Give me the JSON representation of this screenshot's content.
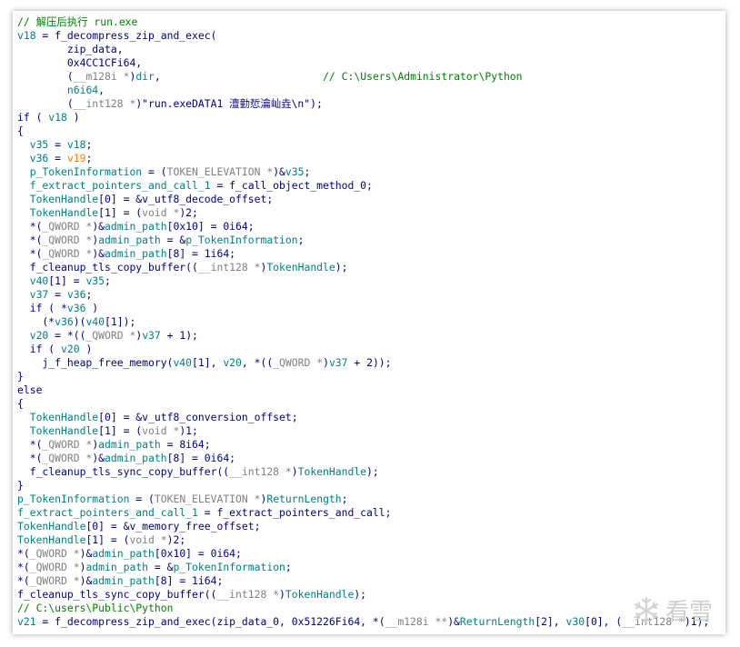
{
  "colors": {
    "background": "#ffffff",
    "text_navy": "#000080",
    "variable_teal": "#008080",
    "type_gray": "#808080",
    "comment_green": "#008000",
    "highlight_orange": "#ff8000"
  },
  "watermark": {
    "text": "看雪",
    "icon": "snowflake-icon"
  },
  "lines": [
    [
      [
        "c",
        "// 解压后执行 run.exe"
      ]
    ],
    [
      [
        "v",
        "v18"
      ],
      [
        "n",
        " = f_decompress_zip_and_exec("
      ]
    ],
    [
      [
        "n",
        "        zip_data,"
      ]
    ],
    [
      [
        "n",
        "        0x4CC1CFi64,"
      ]
    ],
    [
      [
        "n",
        "        ("
      ],
      [
        "y",
        "__m128i *"
      ],
      [
        "n",
        ")"
      ],
      [
        "v",
        "dir"
      ],
      [
        "n",
        ",                          "
      ],
      [
        "c",
        "// C:\\Users\\Administrator\\Python"
      ]
    ],
    [
      [
        "n",
        "        "
      ],
      [
        "v",
        "n6i64"
      ],
      [
        "n",
        ","
      ]
    ],
    [
      [
        "n",
        "        ("
      ],
      [
        "y",
        "__int128 *"
      ],
      [
        "n",
        ")\"run.exeDATA1 澶勭悊瀹屾垚\\n\");"
      ]
    ],
    [
      [
        "n",
        "if ( "
      ],
      [
        "v",
        "v18"
      ],
      [
        "n",
        " )"
      ]
    ],
    [
      [
        "n",
        "{"
      ]
    ],
    [
      [
        "n",
        "  "
      ],
      [
        "v",
        "v35"
      ],
      [
        "n",
        " = "
      ],
      [
        "v",
        "v18"
      ],
      [
        "n",
        ";"
      ]
    ],
    [
      [
        "n",
        "  "
      ],
      [
        "v",
        "v36"
      ],
      [
        "n",
        " = "
      ],
      [
        "o",
        "v19"
      ],
      [
        "n",
        ";"
      ]
    ],
    [
      [
        "n",
        "  "
      ],
      [
        "v",
        "p_TokenInformation"
      ],
      [
        "n",
        " = ("
      ],
      [
        "y",
        "TOKEN_ELEVATION *"
      ],
      [
        "n",
        ")&"
      ],
      [
        "v",
        "v35"
      ],
      [
        "n",
        ";"
      ]
    ],
    [
      [
        "n",
        "  "
      ],
      [
        "v",
        "f_extract_pointers_and_call_1"
      ],
      [
        "n",
        " = f_call_object_method_0;"
      ]
    ],
    [
      [
        "n",
        "  "
      ],
      [
        "v",
        "TokenHandle"
      ],
      [
        "n",
        "[0] = &v_utf8_decode_offset;"
      ]
    ],
    [
      [
        "n",
        "  "
      ],
      [
        "v",
        "TokenHandle"
      ],
      [
        "n",
        "[1] = ("
      ],
      [
        "y",
        "void *"
      ],
      [
        "n",
        ")2;"
      ]
    ],
    [
      [
        "n",
        "  *("
      ],
      [
        "y",
        "_QWORD *"
      ],
      [
        "n",
        ")&"
      ],
      [
        "v",
        "admin_path"
      ],
      [
        "n",
        "[0x10] = 0i64;"
      ]
    ],
    [
      [
        "n",
        "  *("
      ],
      [
        "y",
        "_QWORD *"
      ],
      [
        "n",
        ")"
      ],
      [
        "v",
        "admin_path"
      ],
      [
        "n",
        " = &"
      ],
      [
        "v",
        "p_TokenInformation"
      ],
      [
        "n",
        ";"
      ]
    ],
    [
      [
        "n",
        "  *("
      ],
      [
        "y",
        "_QWORD *"
      ],
      [
        "n",
        ")&"
      ],
      [
        "v",
        "admin_path"
      ],
      [
        "n",
        "[8] = 1i64;"
      ]
    ],
    [
      [
        "n",
        "  f_cleanup_tls_copy_buffer(("
      ],
      [
        "y",
        "__int128 *"
      ],
      [
        "n",
        ")"
      ],
      [
        "v",
        "TokenHandle"
      ],
      [
        "n",
        ");"
      ]
    ],
    [
      [
        "n",
        "  "
      ],
      [
        "v",
        "v40"
      ],
      [
        "n",
        "[1] = "
      ],
      [
        "v",
        "v35"
      ],
      [
        "n",
        ";"
      ]
    ],
    [
      [
        "n",
        "  "
      ],
      [
        "v",
        "v37"
      ],
      [
        "n",
        " = "
      ],
      [
        "v",
        "v36"
      ],
      [
        "n",
        ";"
      ]
    ],
    [
      [
        "n",
        "  if ( *"
      ],
      [
        "v",
        "v36"
      ],
      [
        "n",
        " )"
      ]
    ],
    [
      [
        "n",
        "    (*"
      ],
      [
        "v",
        "v36"
      ],
      [
        "n",
        ")("
      ],
      [
        "v",
        "v40"
      ],
      [
        "n",
        "[1]);"
      ]
    ],
    [
      [
        "n",
        "  "
      ],
      [
        "v",
        "v20"
      ],
      [
        "n",
        " = *(("
      ],
      [
        "y",
        "_QWORD *"
      ],
      [
        "n",
        ")"
      ],
      [
        "v",
        "v37"
      ],
      [
        "n",
        " + 1);"
      ]
    ],
    [
      [
        "n",
        "  if ( "
      ],
      [
        "v",
        "v20"
      ],
      [
        "n",
        " )"
      ]
    ],
    [
      [
        "n",
        "    j_f_heap_free_memory("
      ],
      [
        "v",
        "v40"
      ],
      [
        "n",
        "[1], "
      ],
      [
        "v",
        "v20"
      ],
      [
        "n",
        ", *(("
      ],
      [
        "y",
        "_QWORD *"
      ],
      [
        "n",
        ")"
      ],
      [
        "v",
        "v37"
      ],
      [
        "n",
        " + 2));"
      ]
    ],
    [
      [
        "n",
        "}"
      ]
    ],
    [
      [
        "n",
        "else"
      ]
    ],
    [
      [
        "n",
        "{"
      ]
    ],
    [
      [
        "n",
        "  "
      ],
      [
        "v",
        "TokenHandle"
      ],
      [
        "n",
        "[0] = &v_utf8_conversion_offset;"
      ]
    ],
    [
      [
        "n",
        "  "
      ],
      [
        "v",
        "TokenHandle"
      ],
      [
        "n",
        "[1] = ("
      ],
      [
        "y",
        "void *"
      ],
      [
        "n",
        ")1;"
      ]
    ],
    [
      [
        "n",
        "  *("
      ],
      [
        "y",
        "_QWORD *"
      ],
      [
        "n",
        ")"
      ],
      [
        "v",
        "admin_path"
      ],
      [
        "n",
        " = 8i64;"
      ]
    ],
    [
      [
        "n",
        "  *("
      ],
      [
        "y",
        "_QWORD *"
      ],
      [
        "n",
        ")&"
      ],
      [
        "v",
        "admin_path"
      ],
      [
        "n",
        "[8] = 0i64;"
      ]
    ],
    [
      [
        "n",
        "  f_cleanup_tls_sync_copy_buffer(("
      ],
      [
        "y",
        "__int128 *"
      ],
      [
        "n",
        ")"
      ],
      [
        "v",
        "TokenHandle"
      ],
      [
        "n",
        ");"
      ]
    ],
    [
      [
        "n",
        "}"
      ]
    ],
    [
      [
        "v",
        "p_TokenInformation"
      ],
      [
        "n",
        " = ("
      ],
      [
        "y",
        "TOKEN_ELEVATION *"
      ],
      [
        "n",
        ")"
      ],
      [
        "v",
        "ReturnLength"
      ],
      [
        "n",
        ";"
      ]
    ],
    [
      [
        "v",
        "f_extract_pointers_and_call_1"
      ],
      [
        "n",
        " = f_extract_pointers_and_call;"
      ]
    ],
    [
      [
        "v",
        "TokenHandle"
      ],
      [
        "n",
        "[0] = &v_memory_free_offset;"
      ]
    ],
    [
      [
        "v",
        "TokenHandle"
      ],
      [
        "n",
        "[1] = ("
      ],
      [
        "y",
        "void *"
      ],
      [
        "n",
        ")2;"
      ]
    ],
    [
      [
        "n",
        "*("
      ],
      [
        "y",
        "_QWORD *"
      ],
      [
        "n",
        ")&"
      ],
      [
        "v",
        "admin_path"
      ],
      [
        "n",
        "[0x10] = 0i64;"
      ]
    ],
    [
      [
        "n",
        "*("
      ],
      [
        "y",
        "_QWORD *"
      ],
      [
        "n",
        ")"
      ],
      [
        "v",
        "admin_path"
      ],
      [
        "n",
        " = &"
      ],
      [
        "v",
        "p_TokenInformation"
      ],
      [
        "n",
        ";"
      ]
    ],
    [
      [
        "n",
        "*("
      ],
      [
        "y",
        "_QWORD *"
      ],
      [
        "n",
        ")&"
      ],
      [
        "v",
        "admin_path"
      ],
      [
        "n",
        "[8] = 1i64;"
      ]
    ],
    [
      [
        "n",
        "f_cleanup_tls_sync_copy_buffer(("
      ],
      [
        "y",
        "__int128 *"
      ],
      [
        "n",
        ")"
      ],
      [
        "v",
        "TokenHandle"
      ],
      [
        "n",
        ");"
      ]
    ],
    [
      [
        "c",
        "// C:\\users\\Public\\Python"
      ]
    ],
    [
      [
        "v",
        "v21"
      ],
      [
        "n",
        " = f_decompress_zip_and_exec(zip_data_0, 0x51226Fi64, *("
      ],
      [
        "y",
        "__m128i **"
      ],
      [
        "n",
        ")&"
      ],
      [
        "v",
        "ReturnLength"
      ],
      [
        "n",
        "[2], "
      ],
      [
        "v",
        "v30"
      ],
      [
        "n",
        "[0], ("
      ],
      [
        "y",
        "__int128 *"
      ],
      [
        "n",
        ")1);"
      ]
    ]
  ]
}
